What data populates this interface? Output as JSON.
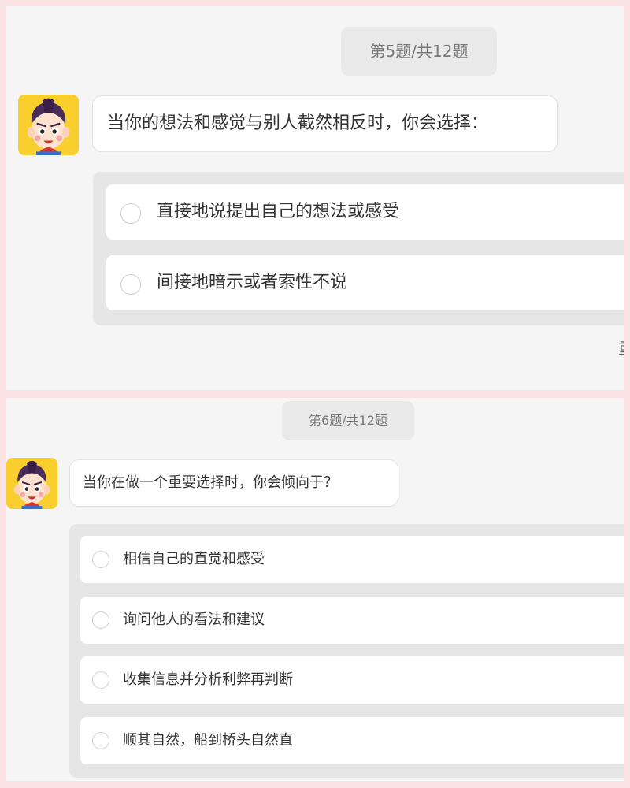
{
  "question_5": {
    "counter": "第5题/共12题",
    "prompt": "当你的想法和感觉与别人截然相反时，你会选择：",
    "options": [
      "直接地说提出自己的想法或感受",
      "间接地暗示或者索性不说"
    ],
    "edge_text": "重"
  },
  "question_6": {
    "counter": "第6题/共12题",
    "prompt": "当你在做一个重要选择时，你会倾向于？",
    "options": [
      "相信自己的直觉和感受",
      "询问他人的看法和建议",
      "收集信息并分析利弊再判断",
      "顺其自然，船到桥头自然直"
    ]
  },
  "colors": {
    "outer_background": "#fbe3e3",
    "panel_background": "#f5f5f5",
    "options_background": "#e6e6e6",
    "avatar_background": "#f9cf2e"
  },
  "icons": {
    "avatar": "cartoon-boy-avatar",
    "radio": "radio-button-unchecked"
  }
}
